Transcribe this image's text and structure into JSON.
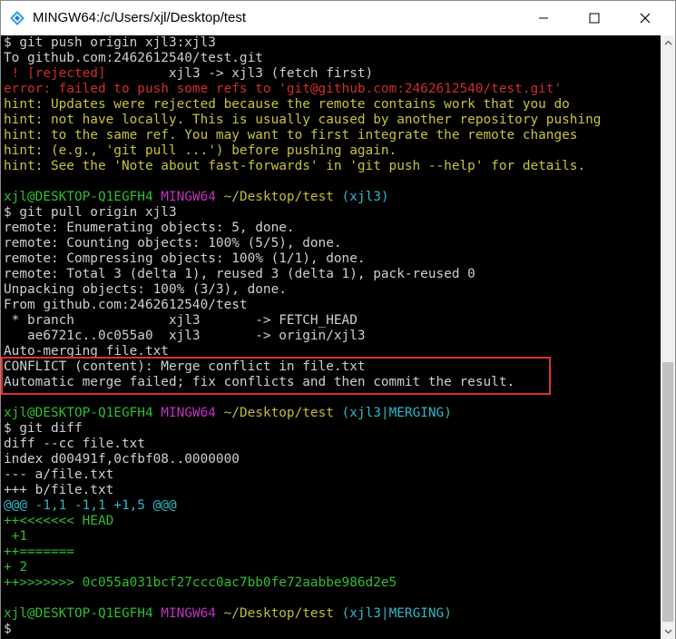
{
  "window": {
    "title": "MINGW64:/c/Users/xjl/Desktop/test"
  },
  "lines": [
    {
      "t": "$ git push origin xjl3:xjl3"
    },
    {
      "t": "To github.com:2462612540/test.git"
    },
    {
      "a": " ! [rejected]",
      "b": "        xjl3 -> xjl3 (fetch first)"
    },
    {
      "t": "error: failed to push some refs to 'git@github.com:2462612540/test.git'"
    },
    {
      "t": "hint: Updates were rejected because the remote contains work that you do"
    },
    {
      "t": "hint: not have locally. This is usually caused by another repository pushing"
    },
    {
      "t": "hint: to the same ref. You may want to first integrate the remote changes"
    },
    {
      "t": "hint: (e.g., 'git pull ...') before pushing again."
    },
    {
      "t": "hint: See the 'Note about fast-forwards' in 'git push --help' for details."
    },
    {
      "t": ""
    },
    {
      "user": "xjl@DESKTOP-Q1EGFH4",
      "sys": "MINGW64",
      "path": "~/Desktop/test",
      "branch": "(xjl3)"
    },
    {
      "t": "$ git pull origin xjl3"
    },
    {
      "t": "remote: Enumerating objects: 5, done."
    },
    {
      "t": "remote: Counting objects: 100% (5/5), done."
    },
    {
      "t": "remote: Compressing objects: 100% (1/1), done."
    },
    {
      "t": "remote: Total 3 (delta 1), reused 3 (delta 1), pack-reused 0"
    },
    {
      "t": "Unpacking objects: 100% (3/3), done."
    },
    {
      "t": "From github.com:2462612540/test"
    },
    {
      "t": " * branch            xjl3       -> FETCH_HEAD"
    },
    {
      "t": "   ae6721c..0c055a0  xjl3       -> origin/xjl3"
    },
    {
      "t": "Auto-merging file.txt"
    },
    {
      "t": "CONFLICT (content): Merge conflict in file.txt"
    },
    {
      "t": "Automatic merge failed; fix conflicts and then commit the result."
    },
    {
      "t": ""
    },
    {
      "user": "xjl@DESKTOP-Q1EGFH4",
      "sys": "MINGW64",
      "path": "~/Desktop/test",
      "branch": "(xjl3|MERGING)"
    },
    {
      "t": "$ git diff"
    },
    {
      "t": "diff --cc file.txt"
    },
    {
      "t": "index d00491f,0cfbf08..0000000"
    },
    {
      "t": "--- a/file.txt"
    },
    {
      "t": "+++ b/file.txt"
    },
    {
      "t": "@@@ -1,1 -1,1 +1,5 @@@"
    },
    {
      "t": "++<<<<<<< HEAD"
    },
    {
      "t": " +1"
    },
    {
      "t": "++======="
    },
    {
      "t": "+ 2"
    },
    {
      "t": "++>>>>>>> 0c055a031bcf27ccc0ac7bb0fe72aabbe986d2e5"
    },
    {
      "t": ""
    },
    {
      "user": "xjl@DESKTOP-Q1EGFH4",
      "sys": "MINGW64",
      "path": "~/Desktop/test",
      "branch": "(xjl3|MERGING)"
    },
    {
      "t": "$"
    }
  ],
  "colors": {
    "text": "#cfcfcf",
    "error": "#d02c2c",
    "hint": "#c7c43a",
    "prompt_user": "#2fbf2f",
    "prompt_sys": "#c431c4",
    "prompt_path": "#bfbf3a",
    "prompt_branch": "#2fb9c7",
    "diff_meta": "#2fb9c7",
    "diff_add": "#2fbf2f",
    "highlight_box": "#e0302f"
  },
  "icons": {
    "app": "mingw-app-icon",
    "minimize": "minimize-icon",
    "maximize": "maximize-icon",
    "close": "close-icon",
    "scroll_up": "chevron-up-icon",
    "scroll_down": "chevron-down-icon"
  }
}
